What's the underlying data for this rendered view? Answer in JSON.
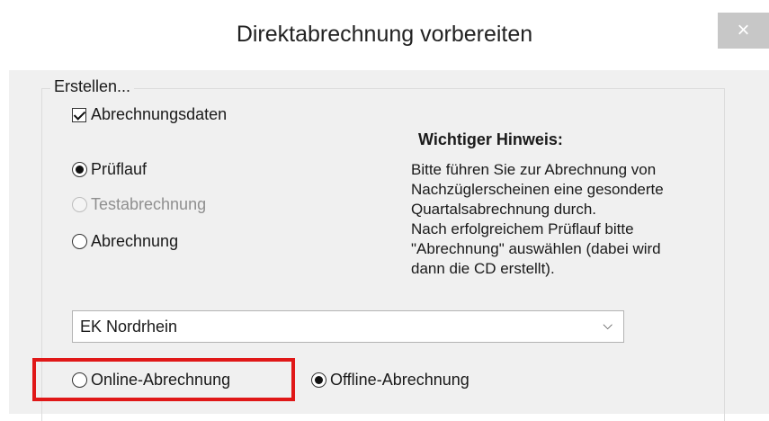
{
  "window": {
    "title": "Direktabrechnung vorbereiten",
    "close_label": "×"
  },
  "group": {
    "label": "Erstellen..."
  },
  "checkbox": {
    "label": "Abrechnungsdaten",
    "checked": true
  },
  "mode_radios": [
    {
      "label": "Prüflauf",
      "selected": true,
      "enabled": true
    },
    {
      "label": "Testabrechnung",
      "selected": false,
      "enabled": false
    },
    {
      "label": "Abrechnung",
      "selected": false,
      "enabled": true
    }
  ],
  "hint": {
    "title": "Wichtiger Hinweis:",
    "lines": [
      "Bitte führen Sie zur Abrechnung von",
      "Nachzüglerscheinen eine gesonderte",
      "Quartalsabrechnung durch.",
      "Nach erfolgreichem Prüflauf bitte",
      "\"Abrechnung\" auswählen (dabei wird",
      "dann die CD erstellt)."
    ]
  },
  "dropdown": {
    "value": "EK Nordrhein"
  },
  "transfer_radios": [
    {
      "label": "Online-Abrechnung",
      "selected": false,
      "highlighted": true
    },
    {
      "label": "Offline-Abrechnung",
      "selected": true,
      "highlighted": false
    }
  ],
  "colors": {
    "dialog_bg": "#f0f0f0",
    "highlight": "#e01818",
    "close_bg": "#c7c7c7"
  }
}
